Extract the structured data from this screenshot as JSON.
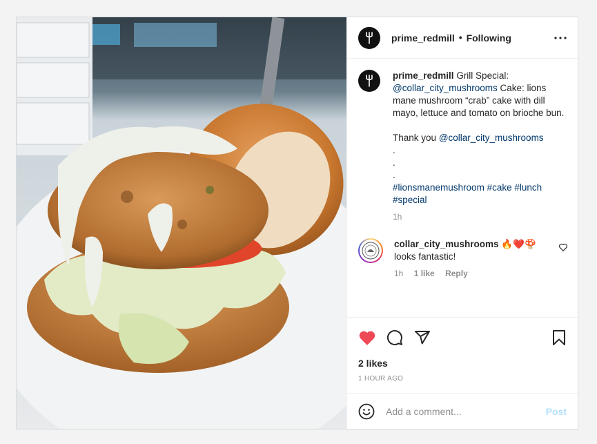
{
  "post": {
    "author": "prime_redmill",
    "separator": "•",
    "follow_status": "Following",
    "more_icon": "more-horizontal-icon"
  },
  "caption": {
    "user": "prime_redmill",
    "text_1": "Grill Special:",
    "mention_1": "@collar_city_mushrooms",
    "text_2": "Cake: lions mane mushroom “crab” cake with dill mayo, lettuce and tomato on brioche bun.",
    "text_3": "Thank you",
    "mention_2": "@collar_city_mushrooms",
    "dots": ".\n.\n.",
    "hashtags": "#lionsmanemushroom #cake #lunch #special",
    "time": "1h"
  },
  "comment": {
    "user": "collar_city_mushrooms",
    "emoji": "🔥❤️🍄",
    "text": "looks fantastic!",
    "time": "1h",
    "likes": "1 like",
    "reply": "Reply"
  },
  "actions": {
    "like_icon": "heart-filled-icon",
    "comment_icon": "comment-icon",
    "share_icon": "share-icon",
    "save_icon": "bookmark-icon",
    "like_color": "#ed4956"
  },
  "stats": {
    "likes": "2 likes",
    "posted": "1 HOUR AGO"
  },
  "composer": {
    "placeholder": "Add a comment...",
    "post_label": "Post"
  }
}
